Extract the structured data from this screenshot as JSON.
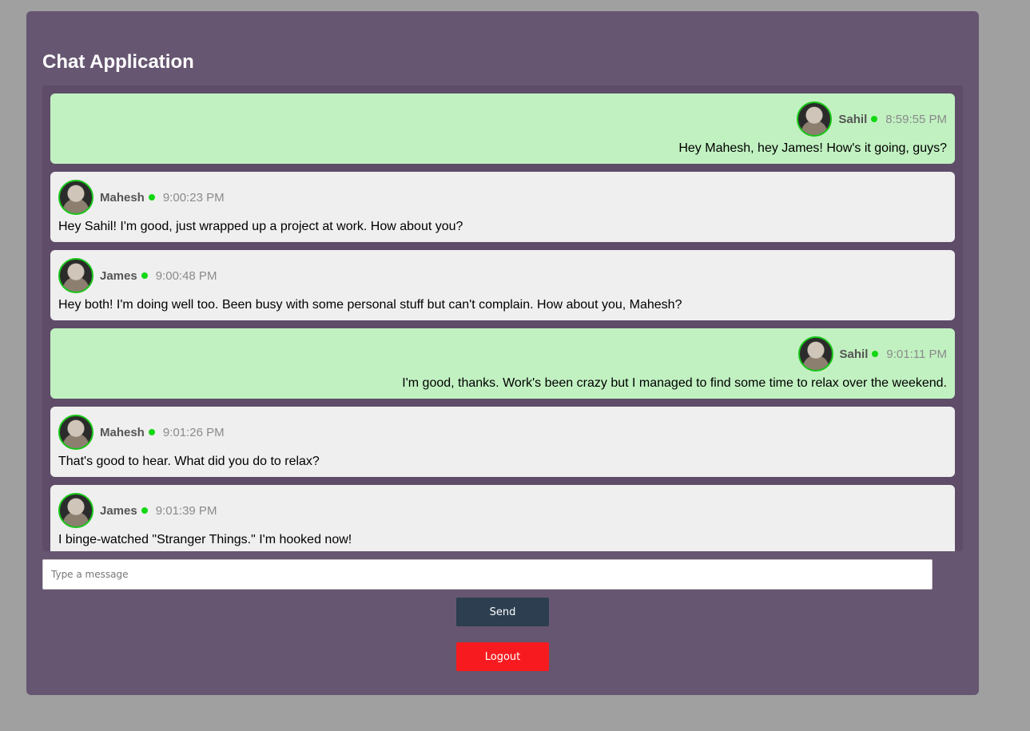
{
  "app": {
    "title": "Chat Application"
  },
  "messages": [
    {
      "user": "Sahil",
      "time": "8:59:55 PM",
      "text": "Hey Mahesh, hey James! How's it going, guys?",
      "self": true
    },
    {
      "user": "Mahesh",
      "time": "9:00:23 PM",
      "text": "Hey Sahil! I'm good, just wrapped up a project at work. How about you?",
      "self": false
    },
    {
      "user": "James",
      "time": "9:00:48 PM",
      "text": "Hey both! I'm doing well too. Been busy with some personal stuff but can't complain. How about you, Mahesh?",
      "self": false
    },
    {
      "user": "Sahil",
      "time": "9:01:11 PM",
      "text": "I'm good, thanks. Work's been crazy but I managed to find some time to relax over the weekend.",
      "self": true
    },
    {
      "user": "Mahesh",
      "time": "9:01:26 PM",
      "text": "That's good to hear. What did you do to relax?",
      "self": false
    },
    {
      "user": "James",
      "time": "9:01:39 PM",
      "text": "I binge-watched \"Stranger Things.\" I'm hooked now!",
      "self": false
    }
  ],
  "composer": {
    "placeholder": "Type a message",
    "value": "",
    "send_label": "Send"
  },
  "logout_label": "Logout",
  "colors": {
    "panel": "#665671",
    "self_bubble": "#c1f1c1",
    "other_bubble": "#efefef",
    "online": "#12d812",
    "send": "#2c3e50",
    "logout": "#f71b1f"
  }
}
